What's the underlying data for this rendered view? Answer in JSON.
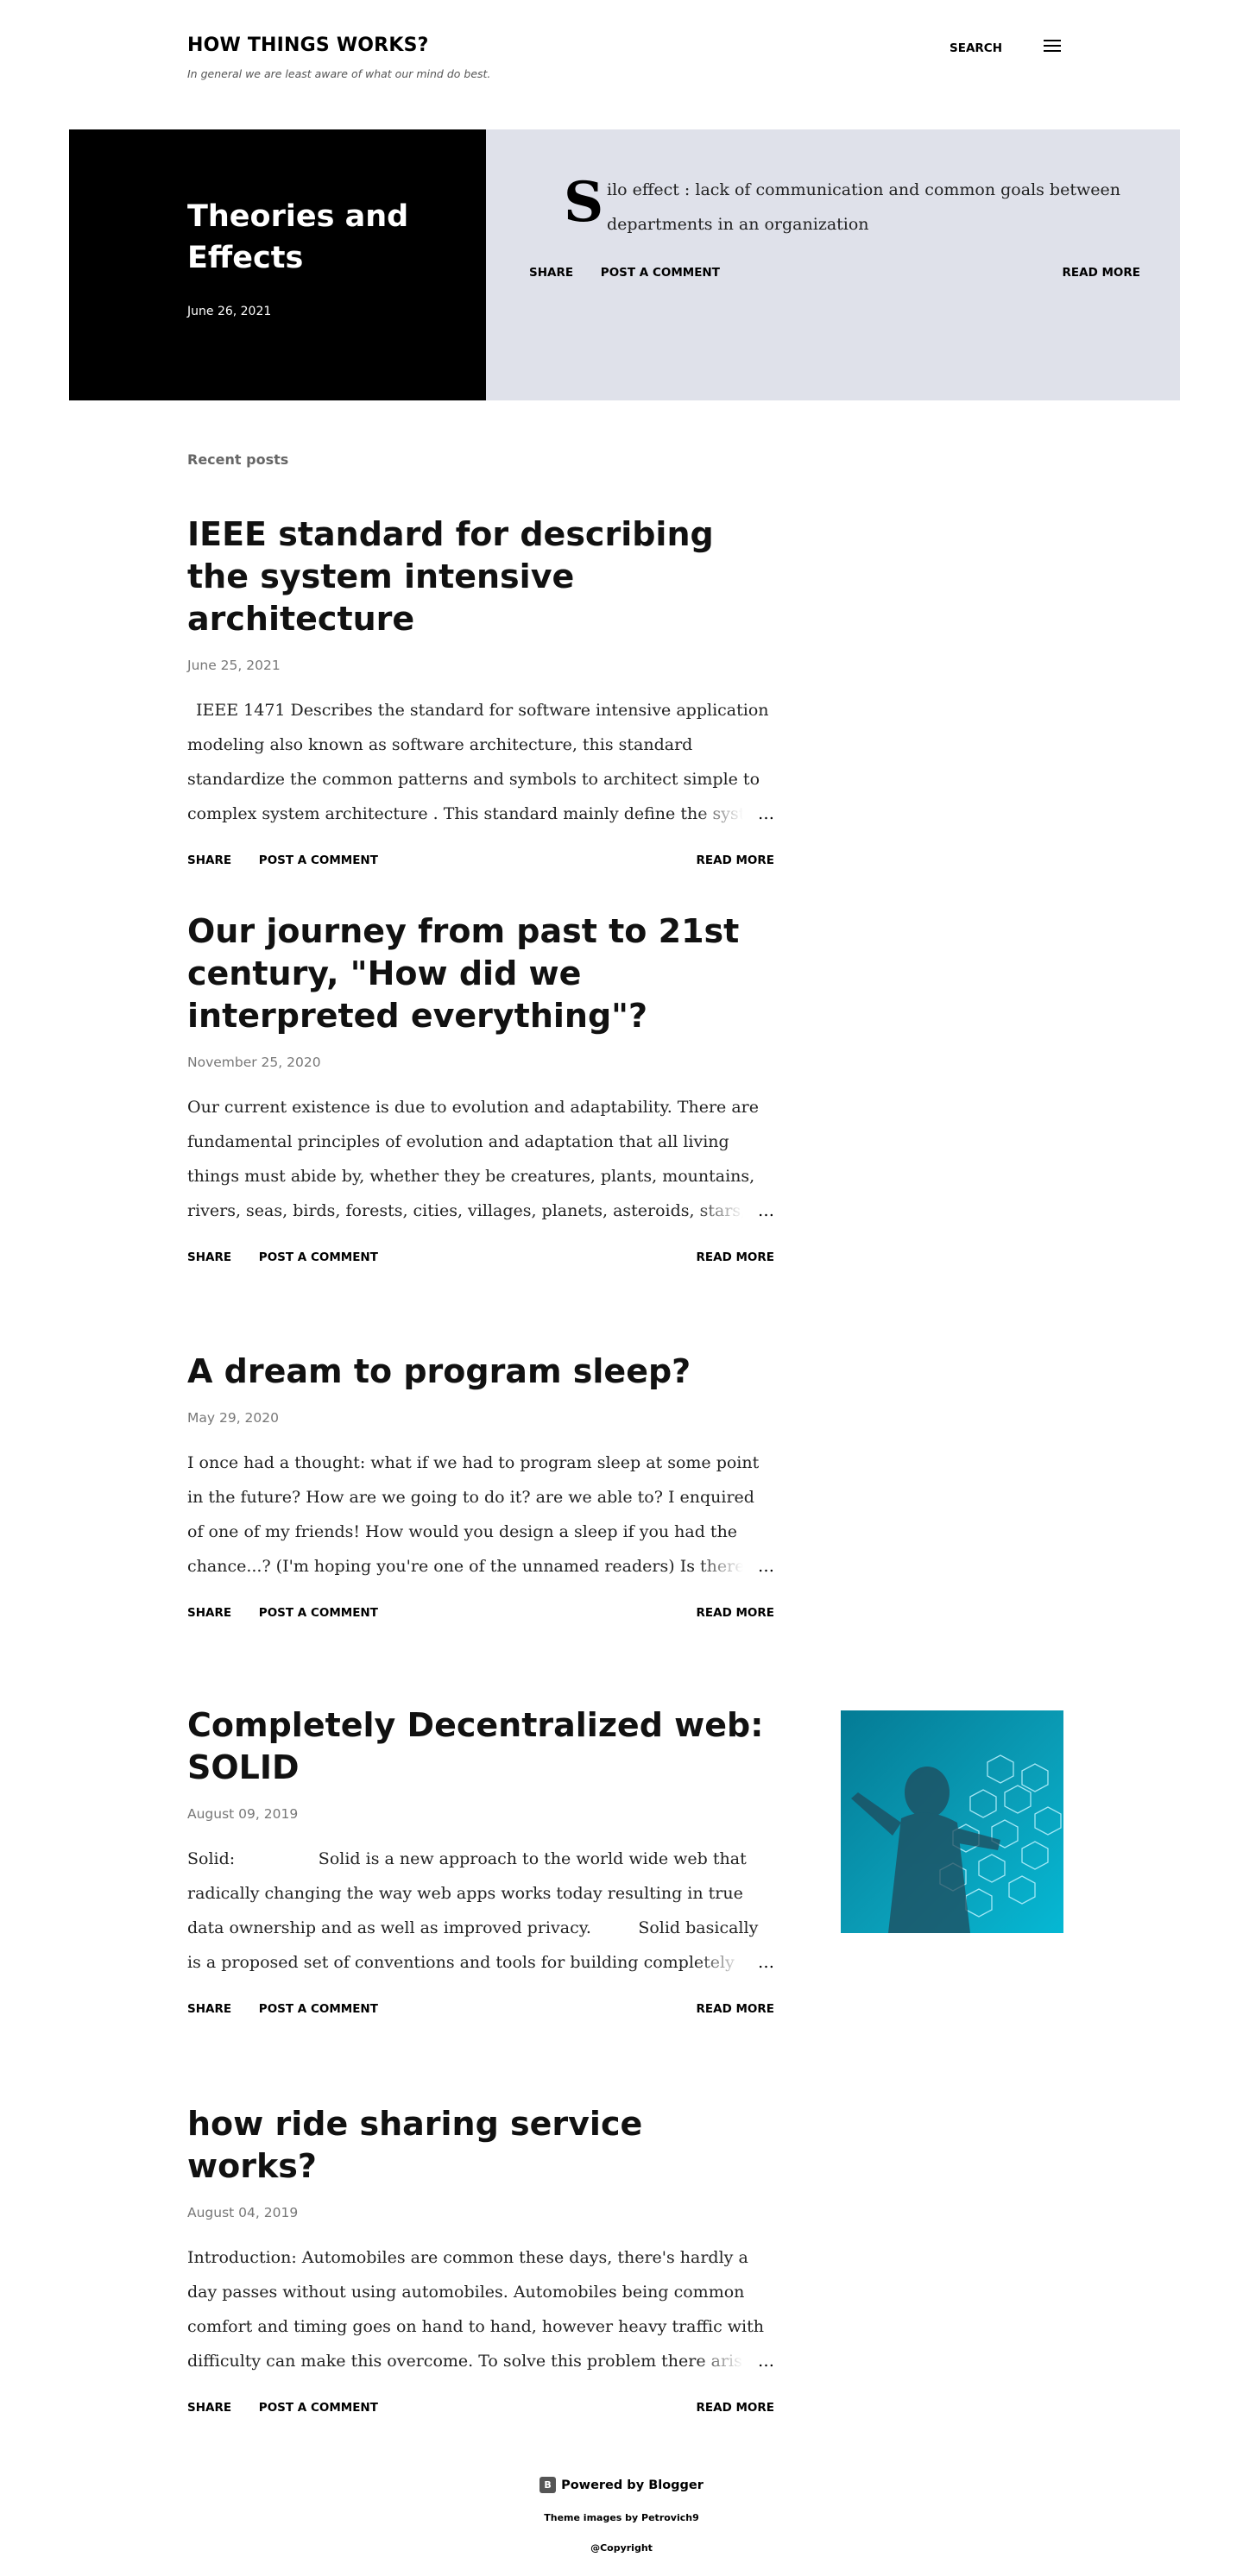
{
  "header": {
    "title": "HOW THINGS WORKS?",
    "description": "In general we are least aware of what our mind do best.",
    "search_label": "SEARCH",
    "menu_icon": "hamburger-menu-icon"
  },
  "featured": {
    "title": "Theories and Effects",
    "date": "June 26, 2021",
    "dropcap": "S",
    "snippet": "ilo effect :  lack of communication and common goals between departments in an organization",
    "share_label": "SHARE",
    "comment_label": "POST A COMMENT",
    "read_more_label": "READ MORE"
  },
  "recent_label": "Recent posts",
  "posts": [
    {
      "title": "IEEE standard for describing the system intensive architecture",
      "date": "June 25, 2021",
      "snippet": "IEEE 1471   Describes the standard for software intensive application modeling also known as software architecture, this standard standardize the common patterns and symbols to architect  simple to complex system architecture . This standard mainly define the system",
      "share_label": "SHARE",
      "comment_label": "POST A COMMENT",
      "read_more_label": "READ MORE"
    },
    {
      "title": "Our journey from past to 21st century, \"How did we interpreted everything\"?",
      "date": "November 25, 2020",
      "snippet": "Our current existence is due to evolution and adaptability. There are fundamental principles of evolution and adaptation that all living things must abide by, whether they be creatures, plants, mountains, rivers, seas, birds, forests, cities, villages, planets, asteroids, stars, software",
      "share_label": "SHARE",
      "comment_label": "POST A COMMENT",
      "read_more_label": "READ MORE"
    },
    {
      "title": "A dream to program sleep?",
      "date": "May 29, 2020",
      "snippet": "I once had a thought: what if we had to program sleep at some point in the future? How are we going to do it? are we able to? I enquired of one of my friends! How would you design a sleep if you had the chance...? (I'm hoping you're one of the unnamed readers) Is there anything you",
      "share_label": "SHARE",
      "comment_label": "POST A COMMENT",
      "read_more_label": "READ MORE"
    },
    {
      "title": "Completely Decentralized web: SOLID",
      "date": "August 09, 2019",
      "snippet": "Solid:                Solid is a new approach to the world wide web that radically changing the way web apps works today resulting in true data ownership and as well as improved privacy.         Solid basically is a proposed set of conventions and tools for building completely",
      "share_label": "SHARE",
      "comment_label": "POST A COMMENT",
      "read_more_label": "READ MORE"
    },
    {
      "title": "how ride sharing service works?",
      "date": "August 04, 2019",
      "snippet": "Introduction: Automobiles are common these days, there's hardly a day passes without using automobiles. Automobiles being common comfort and timing goes on hand to hand, however heavy traffic with difficulty can make this overcome. To solve this problem there arise a concept",
      "share_label": "SHARE",
      "comment_label": "POST A COMMENT",
      "read_more_label": "READ MORE"
    }
  ],
  "ellipsis": "…",
  "footer": {
    "powered_by": "Powered by Blogger",
    "theme_credit": "Theme images by Petrovich9",
    "copyright": "@Copyright"
  },
  "colors": {
    "hero_dark": "#000000",
    "hero_light": "#dfe1ea",
    "thumb_teal": "#0a9cb6"
  }
}
